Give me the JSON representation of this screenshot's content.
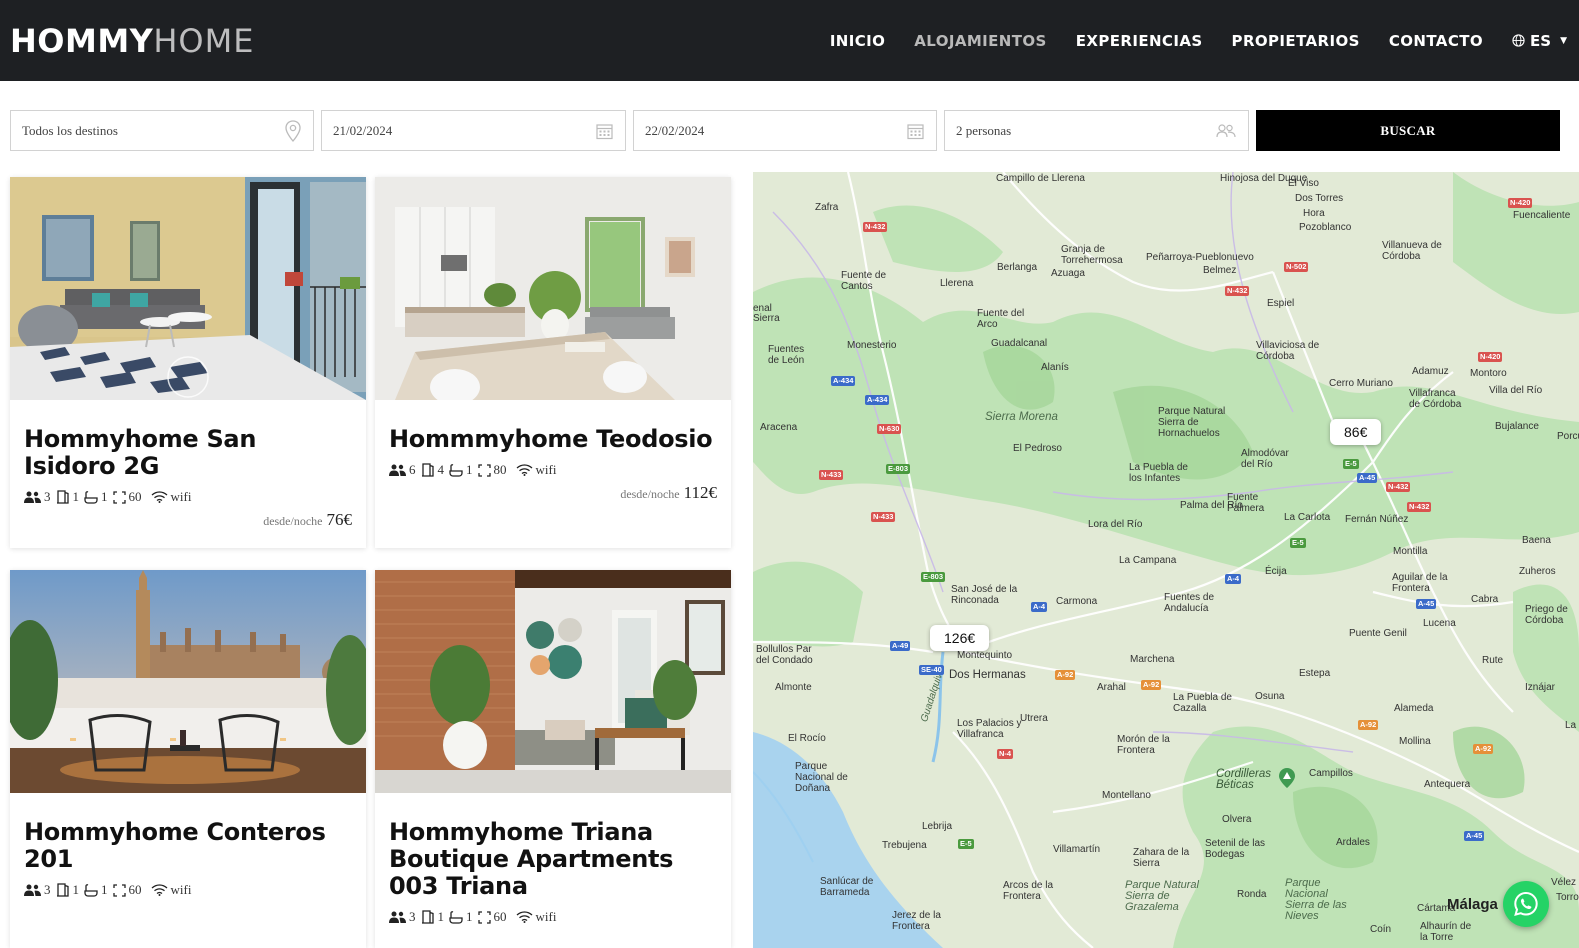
{
  "header": {
    "logo_bold": "HOMMY",
    "logo_thin": "HOME",
    "nav": [
      "INICIO",
      "ALOJAMIENTOS",
      "EXPERIENCIAS",
      "PROPIETARIOS",
      "CONTACTO"
    ],
    "active_nav": "ALOJAMIENTOS",
    "language": "ES",
    "icons": {
      "language": "globe-icon",
      "caret": "chevron-down-icon"
    }
  },
  "search": {
    "destination": "Todos los destinos",
    "checkin": "21/02/2024",
    "checkout": "22/02/2024",
    "guests": "2 personas",
    "button": "BUSCAR",
    "icons": [
      "location-pin-icon",
      "calendar-icon",
      "calendar-icon",
      "people-icon"
    ]
  },
  "listings": [
    {
      "title": "Hommyhome San Isidoro 2G",
      "guests": "3",
      "bedrooms": "1",
      "bathrooms": "1",
      "area": "60",
      "wifi": "wifi",
      "price_prefix": "desde/noche",
      "price": "76€"
    },
    {
      "title": "Hommmyhome Teodosio",
      "guests": "6",
      "bedrooms": "4",
      "bathrooms": "1",
      "area": "80",
      "wifi": "wifi",
      "price_prefix": "desde/noche",
      "price": "112€"
    },
    {
      "title": "Hommyhome Conteros 201",
      "guests": "3",
      "bedrooms": "1",
      "bathrooms": "1",
      "area": "60",
      "wifi": "wifi"
    },
    {
      "title": "Hommyhome Triana Boutique Apartments 003 Triana",
      "guests": "3",
      "bedrooms": "1",
      "bathrooms": "1",
      "area": "60",
      "wifi": "wifi"
    }
  ],
  "map": {
    "price_pins": [
      "86€",
      "126€"
    ],
    "labels": {
      "zafra": "Zafra",
      "fuente_cantos": "Fuente de Cantos",
      "llerena": "Llerena",
      "berlanga": "Berlanga",
      "granja": "Granja de Torrehermosa",
      "azuaga": "Azuaga",
      "penarroya": "Peñarroya-Pueblonuevo",
      "belmez": "Belmez",
      "espiel": "Espiel",
      "elviso": "El Viso",
      "dostorres": "Dos Torres",
      "pozoblanco": "Pozoblanco",
      "villanueva": "Villanueva de Córdoba",
      "fuencaliente": "Fuencaliente",
      "fuentearco": "Fuente del Arco",
      "guadalcanal": "Guadalcanal",
      "monesterio": "Monesterio",
      "fuentesleon": "Fuentes de León",
      "alanis": "Alanís",
      "villaviciosa": "Villaviciosa de Córdoba",
      "cerromuriano": "Cerro Muriano",
      "adamuz": "Adamuz",
      "montoro": "Montoro",
      "villafranca": "Villafranca de Córdoba",
      "villadelrio": "Villa del Río",
      "aracena": "Aracena",
      "sierramorena": "Sierra Morena",
      "parquehorna": "Parque Natural Sierra de Hornachuelos",
      "elpedroso": "El Pedroso",
      "almodovar": "Almodóvar del Río",
      "bujalance": "Bujalance",
      "porcuna": "Porcun",
      "lapuebla": "La Puebla de los Infantes",
      "palmadelrio": "Palma del Río",
      "fuentepalmera": "Fuente Palmera",
      "lacarlota": "La Carlota",
      "fernannunez": "Fernán Núñez",
      "baena": "Baena",
      "loradelrio": "Lora del Río",
      "lacampana": "La Campana",
      "ecija": "Écija",
      "montilla": "Montilla",
      "aguilar": "Aguilar de la Frontera",
      "zuheros": "Zuheros",
      "sanjose": "San José de la Rinconada",
      "carmona": "Carmona",
      "fuentesandalucia": "Fuentes de Andalucía",
      "cabra": "Cabra",
      "priego": "Priego de Córdoba",
      "lucena": "Lucena",
      "puentegenil": "Puente Genil",
      "bollullos": "Bollullos Par del Condado",
      "montequinto": "Montequinto",
      "dosherm": "Dos Hermanas",
      "marchena": "Marchena",
      "estepa": "Estepa",
      "rute": "Rute",
      "iznajar": "Iznájar",
      "almonte": "Almonte",
      "arahal": "Arahal",
      "lapuebladecazalla": "La Puebla de Cazalla",
      "osuna": "Osuna",
      "alameda": "Alameda",
      "lospalacios": "Los Palacios y Villafranca",
      "utrera": "Utrera",
      "moron": "Morón de la Frontera",
      "mollina": "Mollina",
      "elrocio": "El Rocío",
      "guadalquivir": "Guadalquivir",
      "donana": "Parque Nacional de Doñana",
      "cordilleras": "Cordilleras Béticas",
      "campillos": "Campillos",
      "antequera": "Antequera",
      "montellano": "Montellano",
      "lebrija": "Lebrija",
      "olvera": "Olvera",
      "trebujena": "Trebujena",
      "villamartin": "Villamartín",
      "zahara": "Zahara de la Sierra",
      "setenil": "Setenil de las Bodegas",
      "ardales": "Ardales",
      "sanlucar": "Sanlúcar de Barrameda",
      "arcos": "Arcos de la Frontera",
      "grazalema": "Parque Natural Sierra de Grazalema",
      "ronda": "Ronda",
      "nieves": "Parque Nacional Sierra de las Nieves",
      "cartama": "Cártama",
      "coin": "Coín",
      "alhaurin": "Alhaurín de la Torre",
      "malaga": "Málaga",
      "jerez": "Jerez de la Frontera",
      "velez": "Vélez",
      "torre": "Torro",
      "la": "La",
      "enal": "enal",
      "sierra": "Sierra",
      "llerena_top": "Campillo de Llerena",
      "hinojosa": "Hinojosa del Duque",
      "hora": "Hora"
    },
    "roads": [
      "N-432",
      "N-432",
      "N-502",
      "N-420",
      "N-420",
      "A-434",
      "A-434",
      "N-630",
      "N-433",
      "E-803",
      "N-433",
      "E-5",
      "A-45",
      "N-432",
      "N-432",
      "E-5",
      "A-4",
      "E-803",
      "A-4",
      "A-45",
      "A-49",
      "SE-40",
      "A-92",
      "A-92",
      "N-4",
      "A-92",
      "A-92",
      "E-5",
      "A-45"
    ]
  },
  "whatsapp": {
    "icon": "whatsapp-icon"
  }
}
